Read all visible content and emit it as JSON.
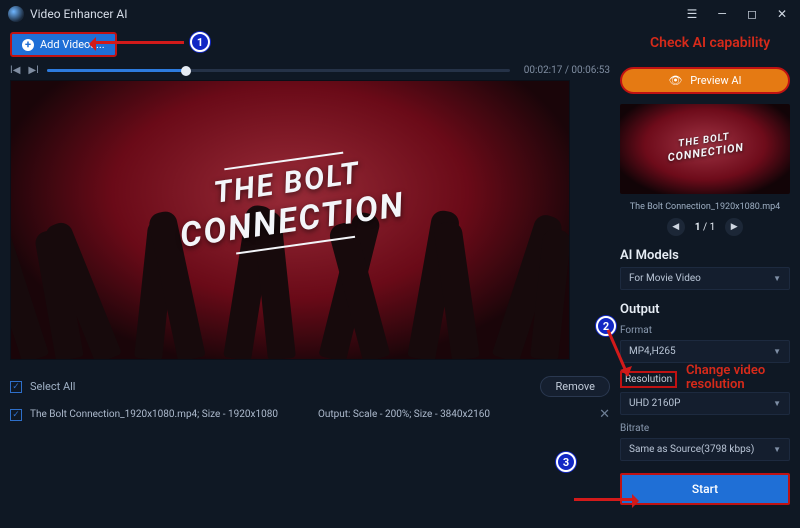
{
  "titlebar": {
    "app_name": "Video Enhancer AI"
  },
  "toolbar": {
    "add_videos_label": "Add Videos..."
  },
  "transport": {
    "time_display": "00:02:17 / 00:06:53",
    "progress_pct": 30
  },
  "preview_title": {
    "line1": "THE BOLT",
    "line2": "CONNECTION"
  },
  "list": {
    "select_all_label": "Select All",
    "remove_label": "Remove",
    "rows": [
      {
        "name": "The Bolt Connection_1920x1080.mp4; Size - 1920x1080",
        "output": "Output: Scale - 200%; Size - 3840x2160"
      }
    ]
  },
  "right": {
    "preview_ai_label": "Preview AI",
    "thumb_title1": "THE BOLT",
    "thumb_title2": "CONNECTION",
    "filename": "The Bolt Connection_1920x1080.mp4",
    "pager_text": "1 / 1",
    "ai_models_heading": "AI Models",
    "ai_model_value": "For Movie Video",
    "output_heading": "Output",
    "format_label": "Format",
    "format_value": "MP4,H265",
    "resolution_label": "Resolution",
    "resolution_value": "UHD 2160P",
    "bitrate_label": "Bitrate",
    "bitrate_value": "Same as Source(3798 kbps)",
    "start_label": "Start"
  },
  "annotations": {
    "check_ai": "Check AI capability",
    "change_res_l1": "Change video",
    "change_res_l2": "resolution",
    "b1": "1",
    "b2": "2",
    "b3": "3"
  }
}
